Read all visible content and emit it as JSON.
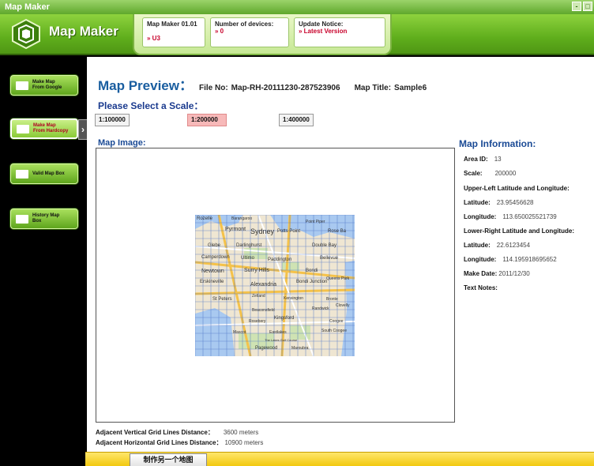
{
  "window": {
    "title": "Map Maker",
    "controls": [
      "-",
      "□"
    ]
  },
  "header": {
    "app_name": "Map Maker",
    "version_label": "Map Maker 01.01",
    "version_value": "» U3",
    "devices_label": "Number of devices:",
    "devices_value": "» 0",
    "update_label": "Update Notice:",
    "update_value": "» Latest Version"
  },
  "sidebar": {
    "items": [
      {
        "label_line1": "Make Map",
        "label_line2": "From Google"
      },
      {
        "label_line1": "Make Map",
        "label_line2": "From Hardcopy"
      },
      {
        "label_line1": "Valid Map Box",
        "label_line2": ""
      },
      {
        "label_line1": "History Map",
        "label_line2": "Box"
      }
    ],
    "arrow": "›"
  },
  "main": {
    "preview_title": "Map Preview：",
    "file_no_label": "File No:",
    "file_no_value": "Map-RH-20111230-287523906",
    "map_title_label": "Map Title:",
    "map_title_value": "Sample6",
    "scale_title": "Please Select a Scale：",
    "scales": [
      "1:100000",
      "1:200000",
      "1:400000"
    ],
    "selected_scale": "1:200000",
    "map_image_title": "Map Image:",
    "map_labels": [
      "Rozelle",
      "Barangaroo",
      "Point Piper",
      "Pyrmont",
      "Sydney",
      "Potts Point",
      "Rose Ba",
      "Glebe",
      "Darlinghurst",
      "Double Bay",
      "Camperdown",
      "Ultimo",
      "Paddington",
      "Bellevue",
      "Newtown",
      "Surry Hills",
      "Bondi",
      "Erskineville",
      "Alexandria",
      "Bondi Junction",
      "Queens Park",
      "St Peters",
      "Zetland",
      "Kensington",
      "Bronte",
      "Beaconsfield",
      "Randwick",
      "Clovelly",
      "Rosebery",
      "Kingsford",
      "Coogee",
      "Mascot",
      "Eastlakes",
      "South Coogee",
      "Pagewood",
      "Maroubra",
      "The Lakes Golf Course"
    ]
  },
  "map_info": {
    "title": "Map Information:",
    "area_id_label": "Area ID:",
    "area_id_value": "13",
    "scale_label": "Scale:",
    "scale_value": "200000",
    "upper_left_label": "Upper-Left Latitude and Longitude:",
    "ul_lat_label": "Latitude:",
    "ul_lat_value": "23.95456628",
    "ul_lon_label": "Longitude:",
    "ul_lon_value": "113.650025521739",
    "lower_right_label": "Lower-Right Latitude and Longitude:",
    "lr_lat_label": "Latitude:",
    "lr_lat_value": "22.6123454",
    "lr_lon_label": "Longitude:",
    "lr_lon_value": "114.195918695652",
    "make_date_label": "Make Date:",
    "make_date_value": "2011/12/30",
    "text_notes_label": "Text Notes:"
  },
  "grid": {
    "vertical_label": "Adjacent Vertical Grid Lines Distance：",
    "vertical_value": "3600 meters",
    "horizontal_label": "Adjacent Horizontal Grid Lines Distance：",
    "horizontal_value": "10900 meters"
  },
  "footer": {
    "make_another_label": "制作另一个地图"
  },
  "colors": {
    "accent_green": "#5fae1c",
    "title_blue": "#1a5ea0",
    "alert_red": "#c8002a",
    "footer_yellow": "#f2c90f"
  }
}
